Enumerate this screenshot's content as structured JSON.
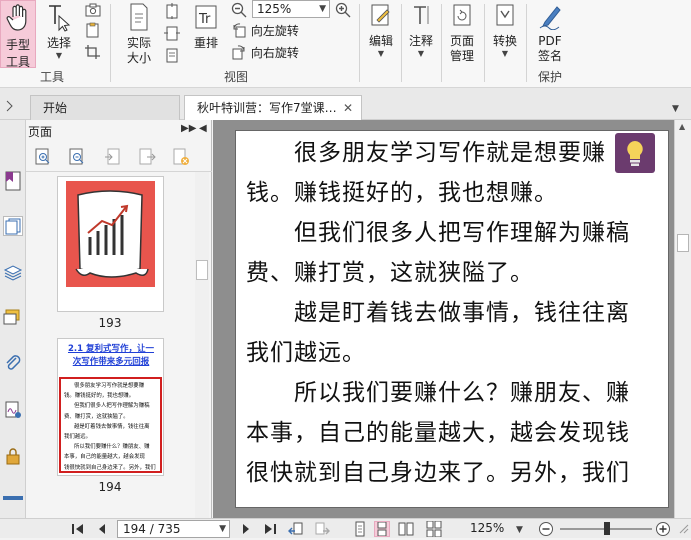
{
  "ribbon": {
    "tools_group": {
      "hand_label": "手型\n工具",
      "hand_l1": "手型",
      "hand_l2": "工具",
      "select_label": "选择",
      "group_label": "工具"
    },
    "view_group": {
      "actual_size_l1": "实际",
      "actual_size_l2": "大小",
      "reflow_label": "重排",
      "zoom_value": "125%",
      "rotate_left": "向左旋转",
      "rotate_right": "向右旋转",
      "group_label": "视图"
    },
    "edit_label": "编辑",
    "annotate_label": "注释",
    "page_mgmt_l1": "页面",
    "page_mgmt_l2": "管理",
    "convert_label": "转换",
    "pdf_sign_l1": "PDF",
    "pdf_sign_l2": "签名",
    "protect_group_label": "保护"
  },
  "tabs": [
    {
      "label": "开始"
    },
    {
      "label": "秋叶特训营：写作7堂课…"
    }
  ],
  "pages_panel": {
    "title": "页面",
    "thumbnails": [
      {
        "page_number": "193"
      },
      {
        "page_number": "194",
        "heading_l1": "2.1 复利式写作，让一",
        "heading_l2": "次写作带来多元回报",
        "text_lines": [
          "很多朋友学习写作就是想要赚",
          "钱。赚钱挺好的，我也想赚。",
          "但我们很多人把写作理解为赚稿",
          "费、赚打赏，这就狭隘了。",
          "越是盯着钱去做事情，钱往往离",
          "我们越远。",
          "所以我们要赚什么？赚朋友、赚",
          "本事，自己的能量越大，越会发现",
          "钱很快就到自己身边来了。另外，我们"
        ]
      }
    ]
  },
  "document": {
    "lines": [
      "很多朋友学习写作就是想要赚",
      "钱。赚钱挺好的，我也想赚。",
      "但我们很多人把写作理解为赚稿",
      "费、赚打赏，这就狭隘了。",
      "越是盯着钱去做事情，钱往往离",
      "我们越远。",
      "所以我们要赚什么？赚朋友、赚",
      "本事，自己的能量越大，越会发现钱",
      "很快就到自己身边来了。另外，我们"
    ]
  },
  "statusbar": {
    "page_indicator": "194 / 735",
    "zoom_value": "125%"
  },
  "colors": {
    "hand_tool_active_bg": "#f6cbd9",
    "bulb_bg": "#6b3b6e",
    "thumb193_bg": "#e8554d",
    "thumb194_border": "#d11f1f",
    "thumb194_heading": "#1f3fd6"
  }
}
